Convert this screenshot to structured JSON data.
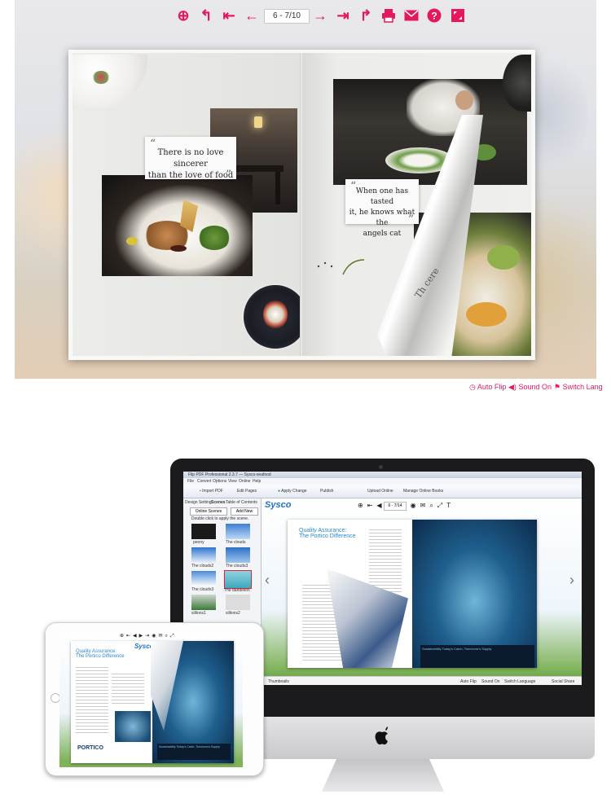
{
  "viewer": {
    "page_indicator": "6 - 7/10",
    "quote_left": [
      "There is no love sincerer",
      "than the love of food"
    ],
    "quote_right": [
      "When one has tasted",
      "it, he knows what the",
      "angels cat"
    ],
    "curl_text": "Th cere",
    "open_quote": "“",
    "close_quote": "”",
    "status": {
      "auto_flip": "Auto Flip",
      "sound_on": "Sound On",
      "switch_lang": "Switch Lang"
    },
    "colors": {
      "accent": "#e6185c"
    }
  },
  "toolbar_icons": [
    "zoom-in-icon",
    "undo-icon",
    "first-page-icon",
    "prev-page-icon",
    "next-page-icon",
    "last-page-icon",
    "share-icon",
    "print-icon",
    "email-icon",
    "help-icon",
    "fullscreen-icon"
  ],
  "imac": {
    "window_title": "Flip PDF Professional 2.3.7 — Sysco-seafood",
    "menu": [
      "File",
      "Convert",
      "Options",
      "View",
      "Online",
      "Help"
    ],
    "ribbon": [
      "Import PDF",
      "Edit Pages",
      "Apply Change",
      "Publish",
      "Upload Online",
      "Manage Online Books"
    ],
    "panel_tabs": [
      "Design Setting",
      "Scenes",
      "Table of Contents"
    ],
    "panel_buttons": [
      "Online Scenes",
      "Add New"
    ],
    "panel_hint": "Double click to apply the scene.",
    "scenes": [
      "peony",
      "The clouds",
      "The clouds2",
      "The clouds3",
      "The clouds3",
      "The dandelion",
      "sillions1",
      "sillions2"
    ],
    "brand": "Sysco",
    "page_indicator": "6 - 7/14",
    "book_title": [
      "Quality Assurance:",
      "The Portico Difference"
    ],
    "article_title": "Sustainability Today's Catch, Tomorrow's Supply",
    "bottom_bar": [
      "Thumbnails",
      "Auto Flip",
      "Sound On",
      "Switch Language",
      "Social Share"
    ]
  },
  "ipad": {
    "brand": "Sysco",
    "book_title": [
      "Quality Assurance:",
      "The Portico Difference"
    ],
    "logo": "PORTICO",
    "article_title": "Sustainability Today's Catch, Tomorrow's Supply"
  }
}
